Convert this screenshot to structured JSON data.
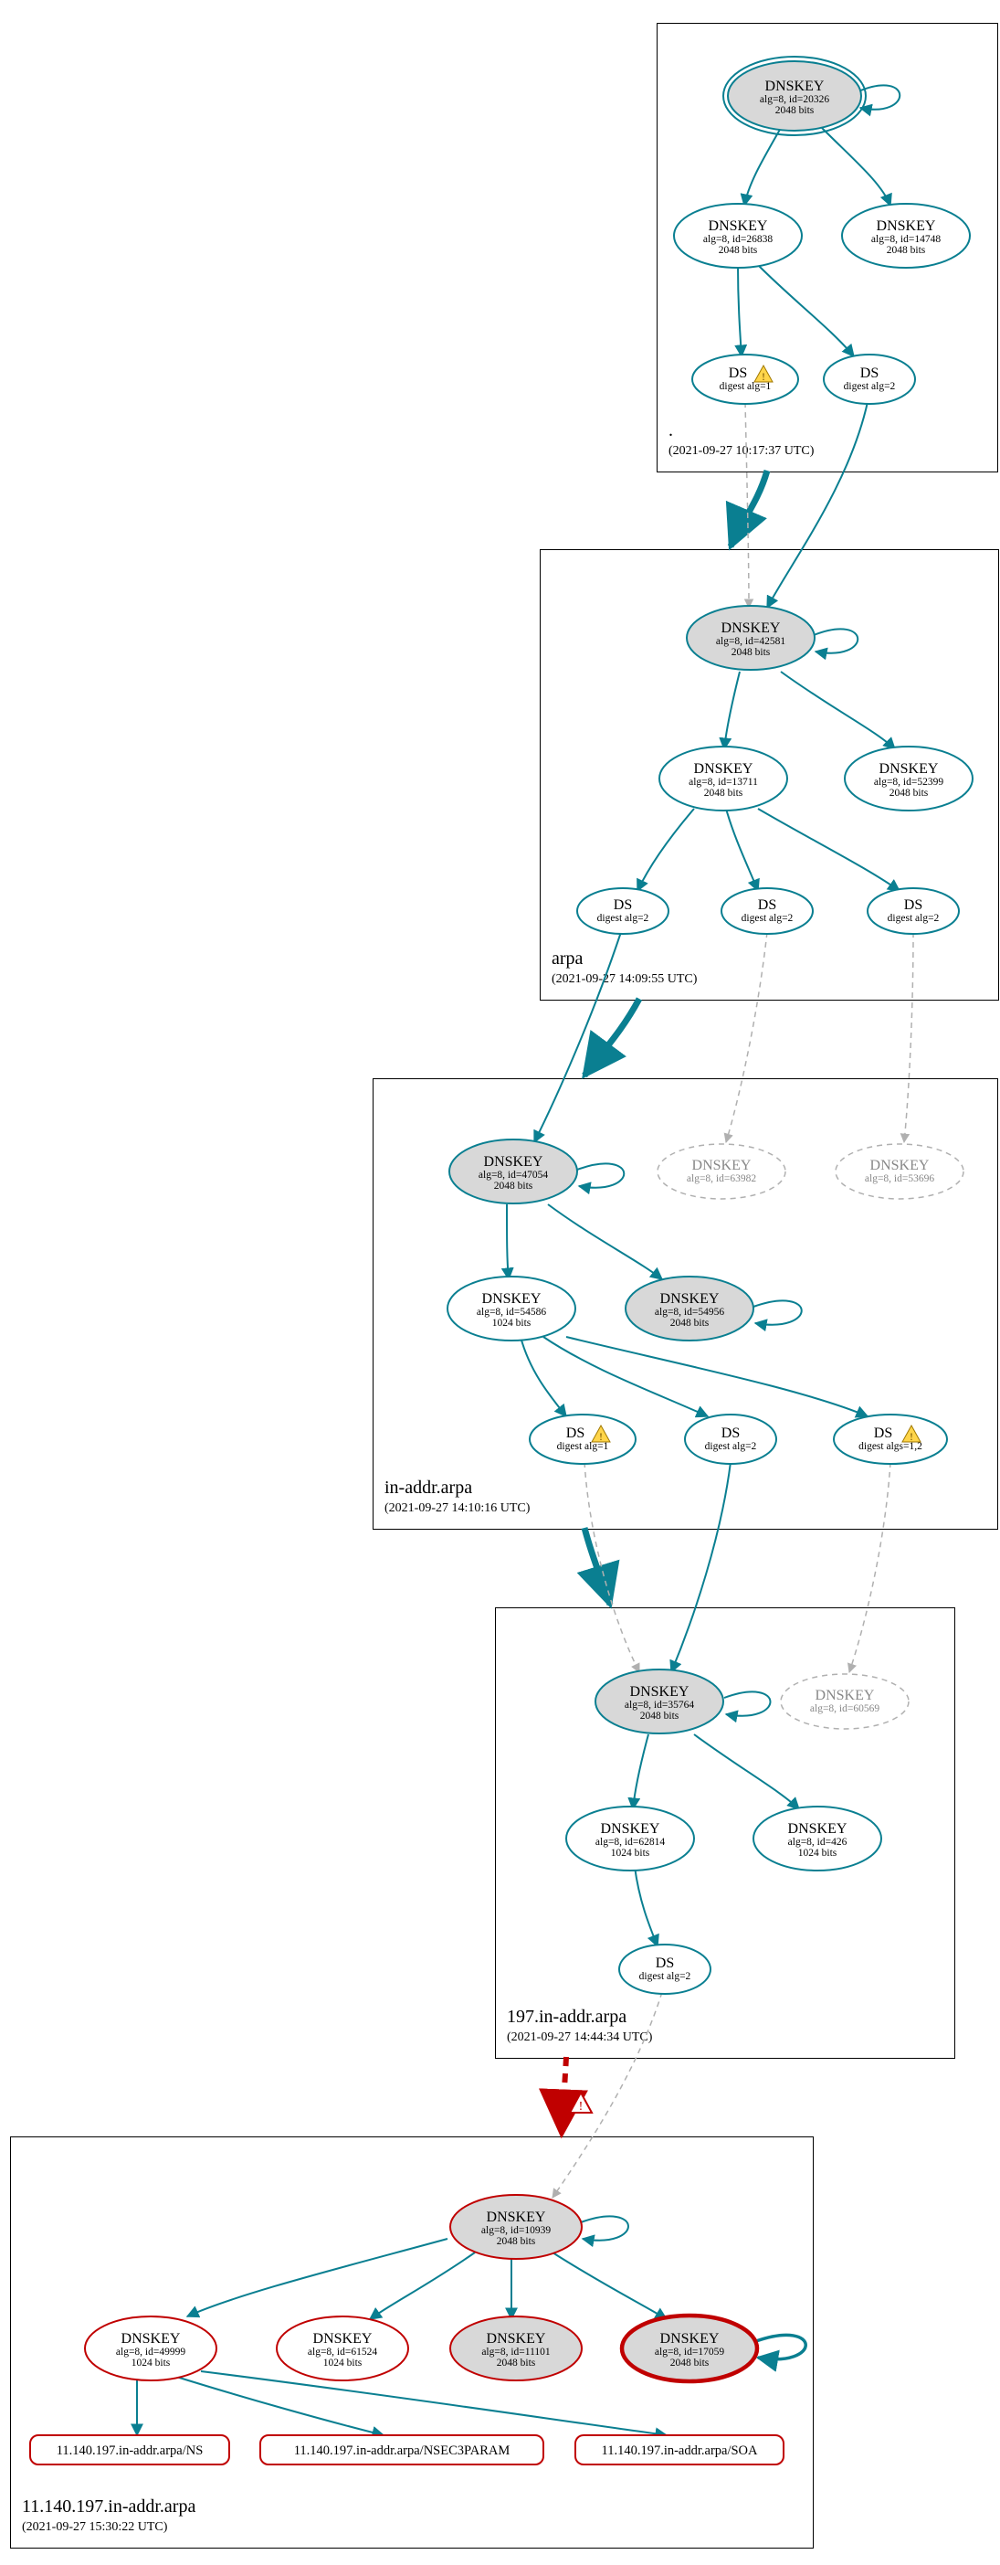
{
  "colors": {
    "teal": "#0a7f91",
    "red": "#c00000",
    "grayFill": "#d8d8d8",
    "grayStroke": "#b0b0b0"
  },
  "zones": {
    "root": {
      "name": ".",
      "ts": "(2021-09-27 10:17:37 UTC)"
    },
    "arpa": {
      "name": "arpa",
      "ts": "(2021-09-27 14:09:55 UTC)"
    },
    "inaddr": {
      "name": "in-addr.arpa",
      "ts": "(2021-09-27 14:10:16 UTC)"
    },
    "z197": {
      "name": "197.in-addr.arpa",
      "ts": "(2021-09-27 14:44:34 UTC)"
    },
    "z11": {
      "name": "11.140.197.in-addr.arpa",
      "ts": "(2021-09-27 15:30:22 UTC)"
    }
  },
  "nodes": {
    "root_k1": {
      "t": "DNSKEY",
      "l1": "alg=8, id=20326",
      "l2": "2048 bits"
    },
    "root_k2": {
      "t": "DNSKEY",
      "l1": "alg=8, id=26838",
      "l2": "2048 bits"
    },
    "root_k3": {
      "t": "DNSKEY",
      "l1": "alg=8, id=14748",
      "l2": "2048 bits"
    },
    "root_ds1": {
      "t": "DS",
      "l1": "digest alg=1"
    },
    "root_ds2": {
      "t": "DS",
      "l1": "digest alg=2"
    },
    "arpa_k1": {
      "t": "DNSKEY",
      "l1": "alg=8, id=42581",
      "l2": "2048 bits"
    },
    "arpa_k2": {
      "t": "DNSKEY",
      "l1": "alg=8, id=13711",
      "l2": "2048 bits"
    },
    "arpa_k3": {
      "t": "DNSKEY",
      "l1": "alg=8, id=52399",
      "l2": "2048 bits"
    },
    "arpa_ds1": {
      "t": "DS",
      "l1": "digest alg=2"
    },
    "arpa_ds2": {
      "t": "DS",
      "l1": "digest alg=2"
    },
    "arpa_ds3": {
      "t": "DS",
      "l1": "digest alg=2"
    },
    "ia_k1": {
      "t": "DNSKEY",
      "l1": "alg=8, id=47054",
      "l2": "2048 bits"
    },
    "ia_gk1": {
      "t": "DNSKEY",
      "l1": "alg=8, id=63982"
    },
    "ia_gk2": {
      "t": "DNSKEY",
      "l1": "alg=8, id=53696"
    },
    "ia_k2": {
      "t": "DNSKEY",
      "l1": "alg=8, id=54586",
      "l2": "1024 bits"
    },
    "ia_k3": {
      "t": "DNSKEY",
      "l1": "alg=8, id=54956",
      "l2": "2048 bits"
    },
    "ia_ds1": {
      "t": "DS",
      "l1": "digest alg=1"
    },
    "ia_ds2": {
      "t": "DS",
      "l1": "digest alg=2"
    },
    "ia_ds3": {
      "t": "DS",
      "l1": "digest algs=1,2"
    },
    "z197_k1": {
      "t": "DNSKEY",
      "l1": "alg=8, id=35764",
      "l2": "2048 bits"
    },
    "z197_gk": {
      "t": "DNSKEY",
      "l1": "alg=8, id=60569"
    },
    "z197_k2": {
      "t": "DNSKEY",
      "l1": "alg=8, id=62814",
      "l2": "1024 bits"
    },
    "z197_k3": {
      "t": "DNSKEY",
      "l1": "alg=8, id=426",
      "l2": "1024 bits"
    },
    "z197_ds": {
      "t": "DS",
      "l1": "digest alg=2"
    },
    "z11_k1": {
      "t": "DNSKEY",
      "l1": "alg=8, id=10939",
      "l2": "2048 bits"
    },
    "z11_k2": {
      "t": "DNSKEY",
      "l1": "alg=8, id=49999",
      "l2": "1024 bits"
    },
    "z11_k3": {
      "t": "DNSKEY",
      "l1": "alg=8, id=61524",
      "l2": "1024 bits"
    },
    "z11_k4": {
      "t": "DNSKEY",
      "l1": "alg=8, id=11101",
      "l2": "2048 bits"
    },
    "z11_k5": {
      "t": "DNSKEY",
      "l1": "alg=8, id=17059",
      "l2": "2048 bits"
    },
    "z11_r1": {
      "t": "11.140.197.in-addr.arpa/NS"
    },
    "z11_r2": {
      "t": "11.140.197.in-addr.arpa/NSEC3PARAM"
    },
    "z11_r3": {
      "t": "11.140.197.in-addr.arpa/SOA"
    }
  },
  "warnIcon": "⚠"
}
